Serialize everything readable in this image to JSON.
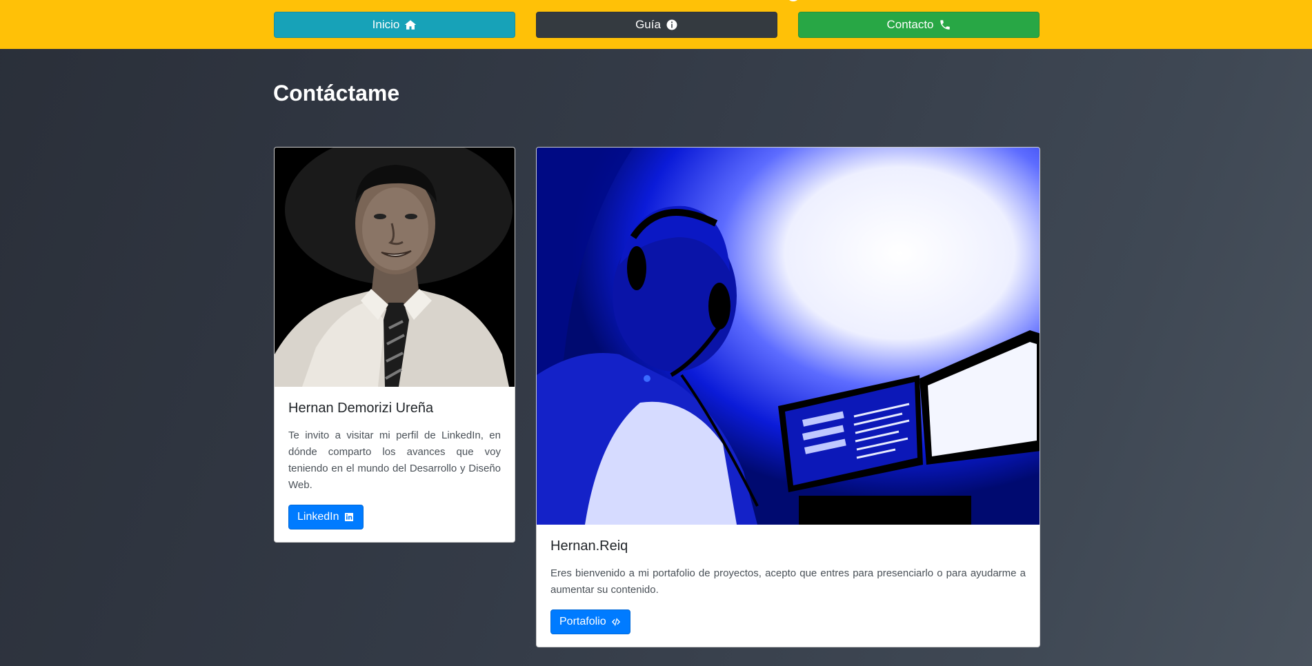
{
  "nav": {
    "inicio_label": "Inicio",
    "guia_label": "Guía",
    "contacto_label": "Contacto",
    "colors": {
      "inicio": "#17a2b8",
      "guia": "#343a40",
      "contacto": "#28a745",
      "bar": "#ffc107"
    },
    "icons": {
      "inicio": "home-icon",
      "guia": "info-circle-icon",
      "contacto": "phone-icon"
    }
  },
  "page": {
    "title": "Contáctame"
  },
  "cards": [
    {
      "title": "Hernan Demorizi Ureña",
      "text": "Te invito a visitar mi perfil de LinkedIn, en dónde comparto los avances que voy teniendo en el mundo del Desarrollo y Diseño Web.",
      "button_label": "LinkedIn",
      "button_icon": "linkedin-icon",
      "image": "portrait-photo"
    },
    {
      "title": "Hernan.Reiq",
      "text": "Eres bienvenido a mi portafolio de proyectos, acepto que entres para presenciarlo o para ayudarme a aumentar su contenido.",
      "button_label": "Portafolio",
      "button_icon": "code-icon",
      "image": "developer-desk-photo"
    }
  ],
  "accent": "#007bff"
}
